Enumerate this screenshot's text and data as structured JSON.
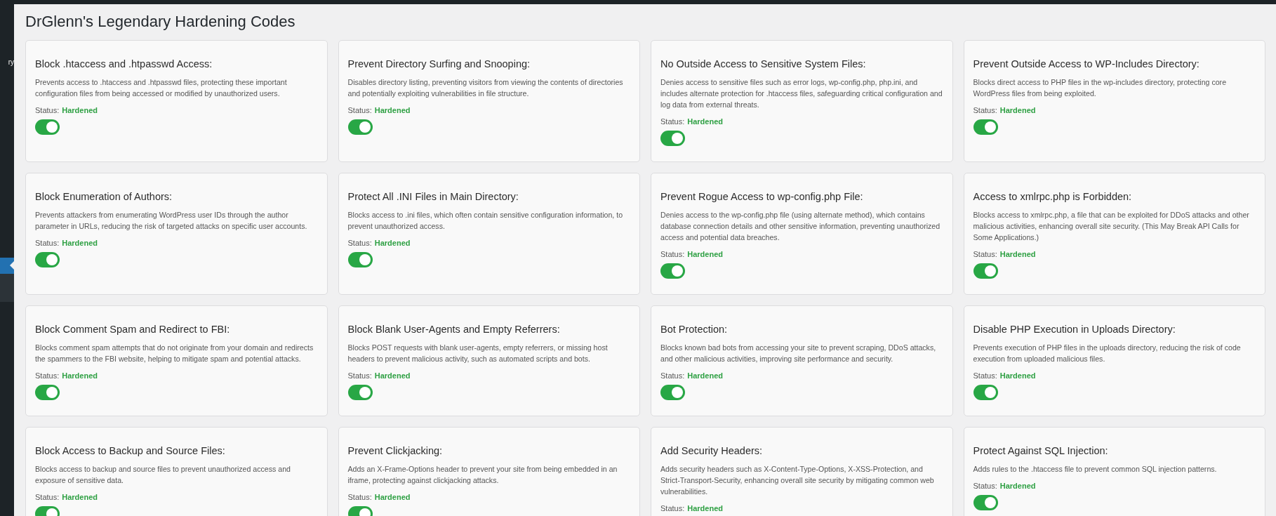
{
  "sidebar": {
    "label": "ry"
  },
  "page": {
    "title": "DrGlenn's Legendary Hardening Codes"
  },
  "cards": [
    {
      "title": "Block .htaccess and .htpasswd Access:",
      "description": "Prevents access to .htaccess and .htpasswd files, protecting these important configuration files from being accessed or modified by unauthorized users.",
      "status_label": "Status:",
      "status": "Hardened",
      "on": true
    },
    {
      "title": "Prevent Directory Surfing and Snooping:",
      "description": "Disables directory listing, preventing visitors from viewing the contents of directories and potentially exploiting vulnerabilities in file structure.",
      "status_label": "Status:",
      "status": "Hardened",
      "on": true
    },
    {
      "title": "No Outside Access to Sensitive System Files:",
      "description": "Denies access to sensitive files such as error logs, wp-config.php, php.ini, and includes alternate protection for .htaccess files, safeguarding critical configuration and log data from external threats.",
      "status_label": "Status:",
      "status": "Hardened",
      "on": true
    },
    {
      "title": "Prevent Outside Access to WP-Includes Directory:",
      "description": "Blocks direct access to PHP files in the wp-includes directory, protecting core WordPress files from being exploited.",
      "status_label": "Status:",
      "status": "Hardened",
      "on": true
    },
    {
      "title": "Block Enumeration of Authors:",
      "description": "Prevents attackers from enumerating WordPress user IDs through the author parameter in URLs, reducing the risk of targeted attacks on specific user accounts.",
      "status_label": "Status:",
      "status": "Hardened",
      "on": true
    },
    {
      "title": "Protect All .INI Files in Main Directory:",
      "description": "Blocks access to .ini files, which often contain sensitive configuration information, to prevent unauthorized access.",
      "status_label": "Status:",
      "status": "Hardened",
      "on": true
    },
    {
      "title": "Prevent Rogue Access to wp-config.php File:",
      "description": "Denies access to the wp-config.php file (using alternate method), which contains database connection details and other sensitive information, preventing unauthorized access and potential data breaches.",
      "status_label": "Status:",
      "status": "Hardened",
      "on": true
    },
    {
      "title": "Access to xmlrpc.php is Forbidden:",
      "description": "Blocks access to xmlrpc.php, a file that can be exploited for DDoS attacks and other malicious activities, enhancing overall site security. (This May Break API Calls for Some Applications.)",
      "status_label": "Status:",
      "status": "Hardened",
      "on": true
    },
    {
      "title": "Block Comment Spam and Redirect to FBI:",
      "description": "Blocks comment spam attempts that do not originate from your domain and redirects the spammers to the FBI website, helping to mitigate spam and potential attacks.",
      "status_label": "Status:",
      "status": "Hardened",
      "on": true
    },
    {
      "title": "Block Blank User-Agents and Empty Referrers:",
      "description": "Blocks POST requests with blank user-agents, empty referrers, or missing host headers to prevent malicious activity, such as automated scripts and bots.",
      "status_label": "Status:",
      "status": "Hardened",
      "on": true
    },
    {
      "title": "Bot Protection:",
      "description": "Blocks known bad bots from accessing your site to prevent scraping, DDoS attacks, and other malicious activities, improving site performance and security.",
      "status_label": "Status:",
      "status": "Hardened",
      "on": true
    },
    {
      "title": "Disable PHP Execution in Uploads Directory:",
      "description": "Prevents execution of PHP files in the uploads directory, reducing the risk of code execution from uploaded malicious files.",
      "status_label": "Status:",
      "status": "Hardened",
      "on": true
    },
    {
      "title": "Block Access to Backup and Source Files:",
      "description": "Blocks access to backup and source files to prevent unauthorized access and exposure of sensitive data.",
      "status_label": "Status:",
      "status": "Hardened",
      "on": true
    },
    {
      "title": "Prevent Clickjacking:",
      "description": "Adds an X-Frame-Options header to prevent your site from being embedded in an iframe, protecting against clickjacking attacks.",
      "status_label": "Status:",
      "status": "Hardened",
      "on": true
    },
    {
      "title": "Add Security Headers:",
      "description": "Adds security headers such as X-Content-Type-Options, X-XSS-Protection, and Strict-Transport-Security, enhancing overall site security by mitigating common web vulnerabilities.",
      "status_label": "Status:",
      "status": "Hardened"
    },
    {
      "title": "Protect Against SQL Injection:",
      "description": "Adds rules to the .htaccess file to prevent common SQL injection patterns.",
      "status_label": "Status:",
      "status": "Hardened",
      "on": true
    }
  ]
}
